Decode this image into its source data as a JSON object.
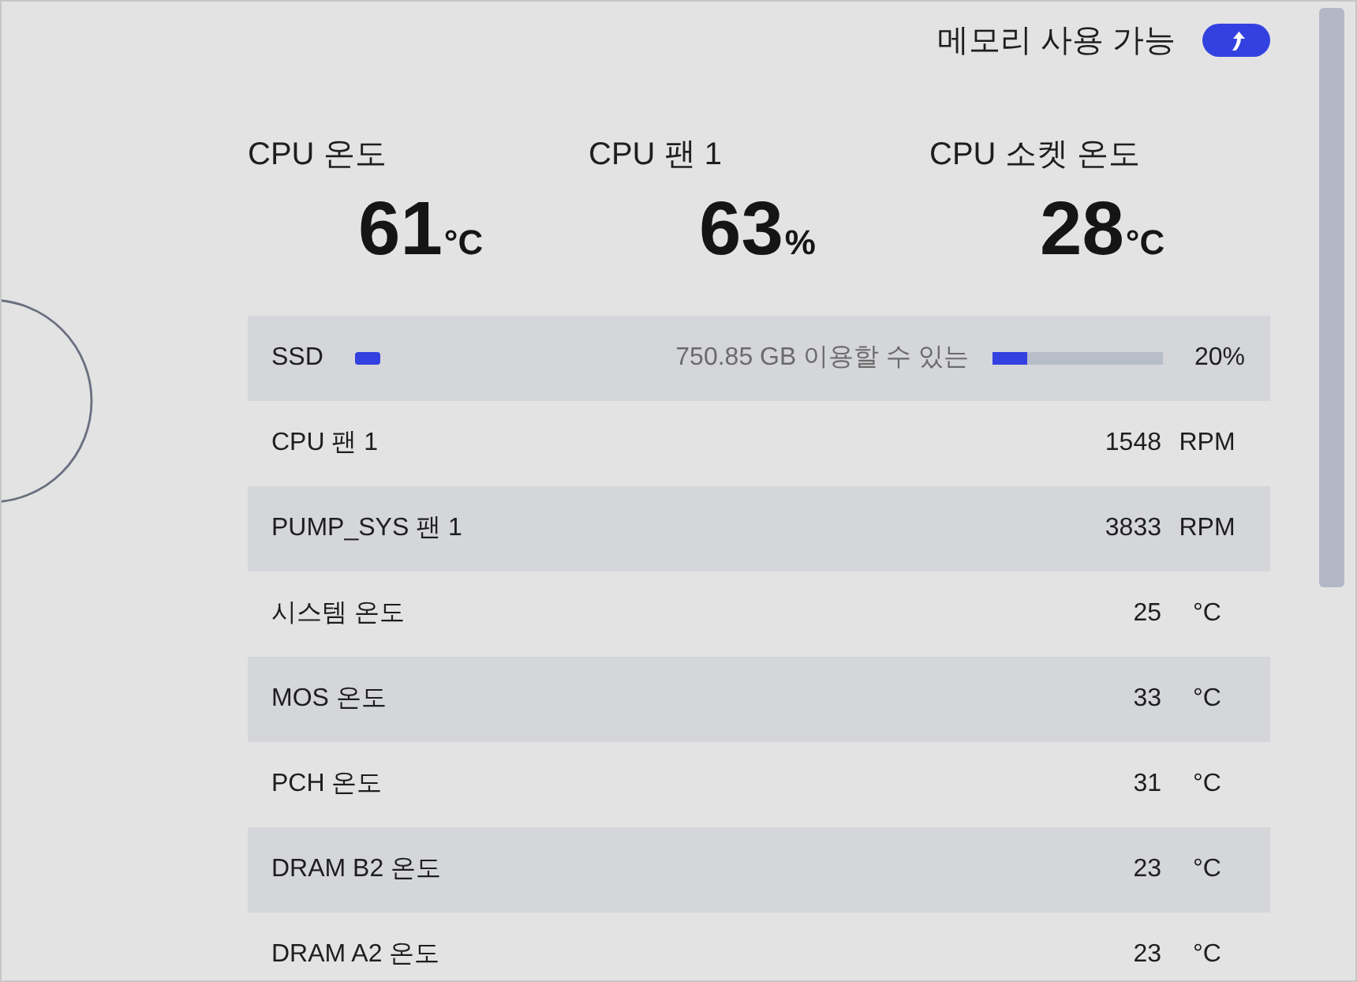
{
  "header": {
    "label": "메모리 사용 가능"
  },
  "stats": [
    {
      "label": "CPU 온도",
      "value": "61",
      "unit": "°C"
    },
    {
      "label": "CPU 팬 1",
      "value": "63",
      "unit": "%"
    },
    {
      "label": "CPU 소켓 온도",
      "value": "28",
      "unit": "°C"
    }
  ],
  "rows": [
    {
      "kind": "storage",
      "label": "SSD",
      "free": "750.85 GB 이용할 수 있는",
      "level": 0.2,
      "percent": "20%"
    },
    {
      "kind": "reading",
      "label": "CPU 팬 1",
      "value": "1548",
      "unit": "RPM"
    },
    {
      "kind": "reading",
      "label": "PUMP_SYS 팬 1",
      "value": "3833",
      "unit": "RPM"
    },
    {
      "kind": "reading",
      "label": "시스템 온도",
      "value": "25",
      "unit": "°C"
    },
    {
      "kind": "reading",
      "label": "MOS 온도",
      "value": "33",
      "unit": "°C"
    },
    {
      "kind": "reading",
      "label": "PCH 온도",
      "value": "31",
      "unit": "°C"
    },
    {
      "kind": "reading",
      "label": "DRAM B2 온도",
      "value": "23",
      "unit": "°C"
    },
    {
      "kind": "reading",
      "label": "DRAM A2 온도",
      "value": "23",
      "unit": "°C"
    }
  ]
}
